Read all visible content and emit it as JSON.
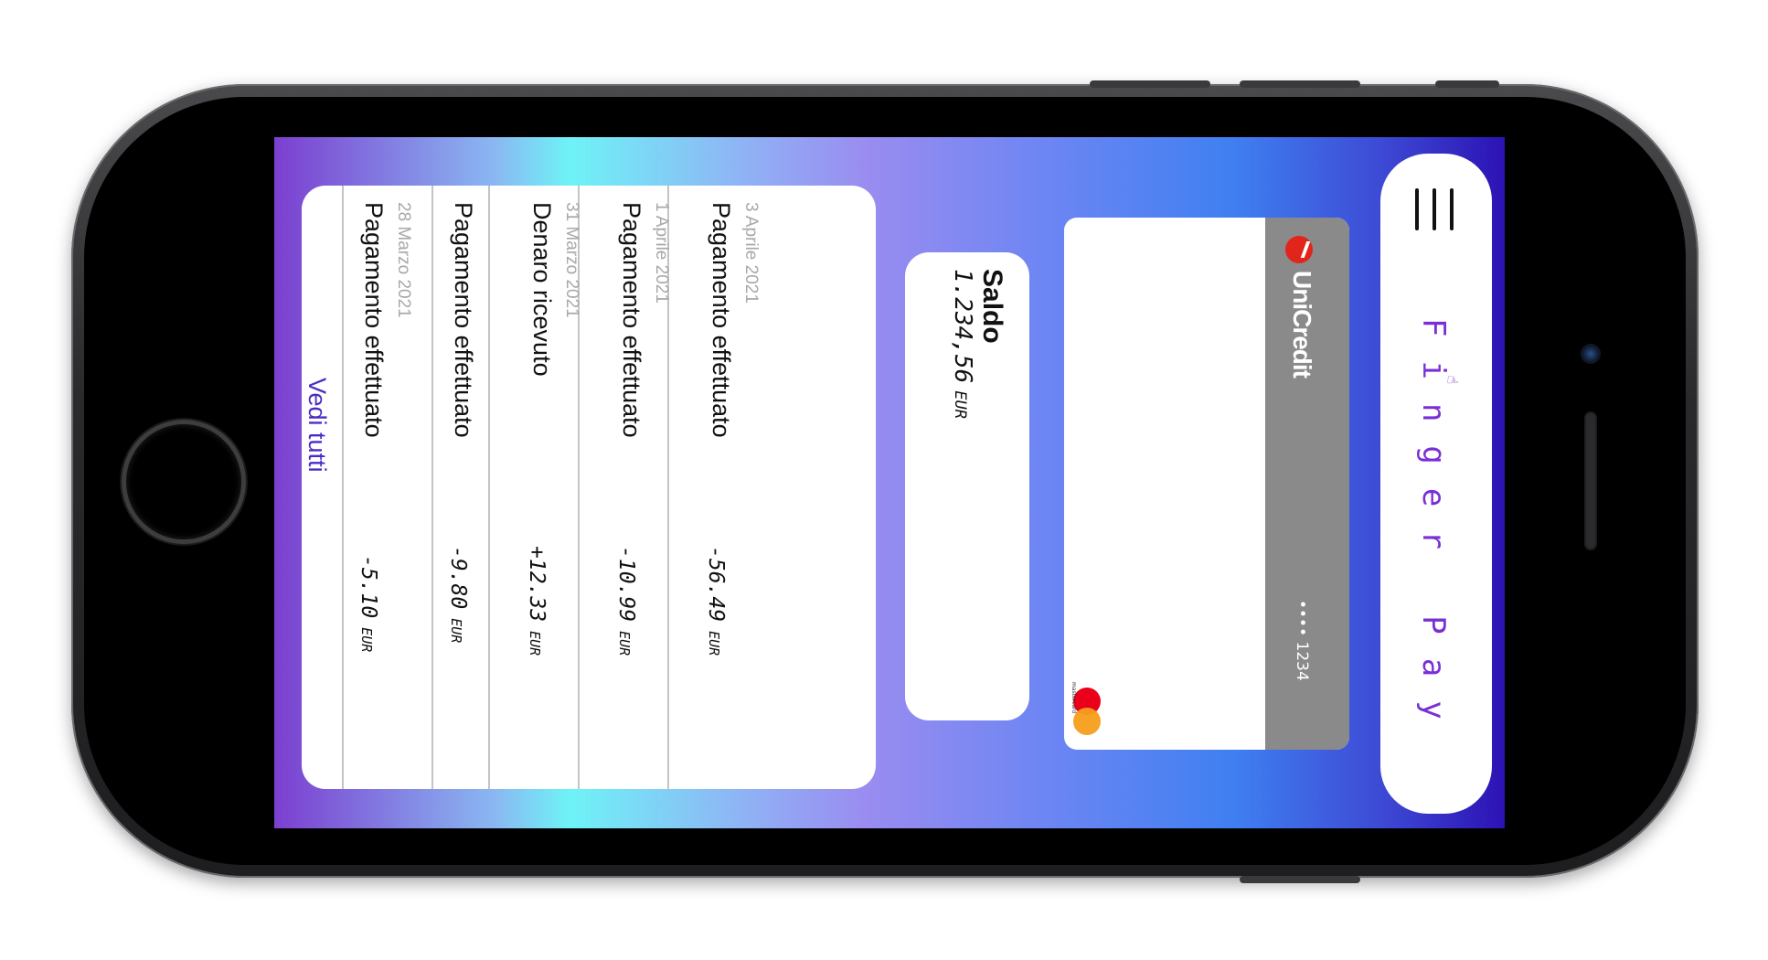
{
  "app": {
    "name": "Finger Pay"
  },
  "card": {
    "bank": "UniCredit",
    "number_masked": "•••• 1234",
    "network": "mastercard"
  },
  "balance": {
    "title": "Saldo",
    "amount": "1.234,56",
    "currency": "EUR"
  },
  "transactions": [
    {
      "date": "3 Aprile 2021",
      "description": "Pagamento effettuato",
      "amount": "-56.49",
      "currency": "EUR"
    },
    {
      "date": "1 Aprile 2021",
      "description": "Pagamento effettuato",
      "amount": "-10.99",
      "currency": "EUR"
    },
    {
      "date": "31 Marzo 2021",
      "description": "Denaro ricevuto",
      "amount": "+12.33",
      "currency": "EUR"
    },
    {
      "date": "",
      "description": "Pagamento effettuato",
      "amount": "-9.80",
      "currency": "EUR"
    },
    {
      "date": "28 Marzo 2021",
      "description": "Pagamento effettuato",
      "amount": "-5.10",
      "currency": "EUR"
    }
  ],
  "see_all_label": "Vedi tutti",
  "icons": {
    "menu": "hamburger-menu-icon",
    "brand": "hand-icon",
    "network_logo": "mastercard-logo-icon",
    "bank_logo": "unicredit-logo-icon"
  },
  "colors": {
    "accent": "#7a2fd6",
    "link": "#4b2cc9",
    "bank_red": "#e1251b"
  }
}
